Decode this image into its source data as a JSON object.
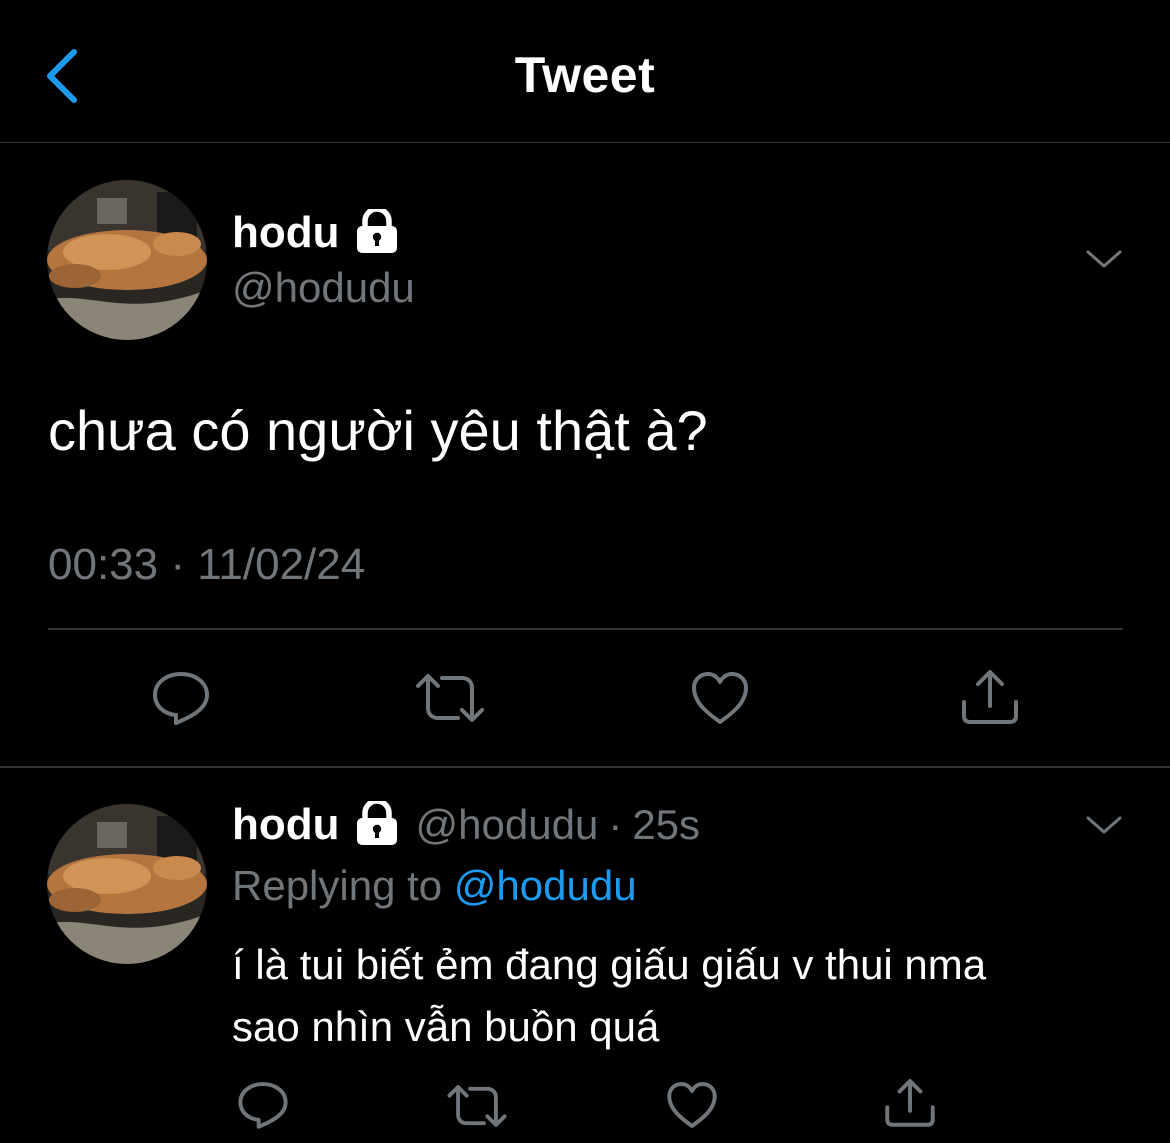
{
  "header": {
    "title": "Tweet"
  },
  "main_tweet": {
    "display_name": "hodu",
    "handle": "@hodudu",
    "text": "chưa có người yêu thật à?",
    "timestamp": "00:33 · 11/02/24"
  },
  "reply": {
    "display_name": "hodu",
    "handle": "@hodudu",
    "separator": "·",
    "time_ago": "25s",
    "replying_label": "Replying to",
    "replying_to": "@hodudu",
    "text_line1": "í là tui biết ẻm đang giấu giấu v thui nma",
    "text_line2": "sao nhìn vẫn buồn quá"
  },
  "icons": {
    "back": "chevron-left-icon",
    "lock": "lock-icon",
    "more": "chevron-down-icon",
    "reply": "comment-icon",
    "retweet": "retweet-icon",
    "like": "heart-icon",
    "share": "share-icon"
  },
  "colors": {
    "background": "#000000",
    "accent": "#1d9bf0",
    "secondary_text": "#71767b",
    "divider": "#2f3336"
  }
}
